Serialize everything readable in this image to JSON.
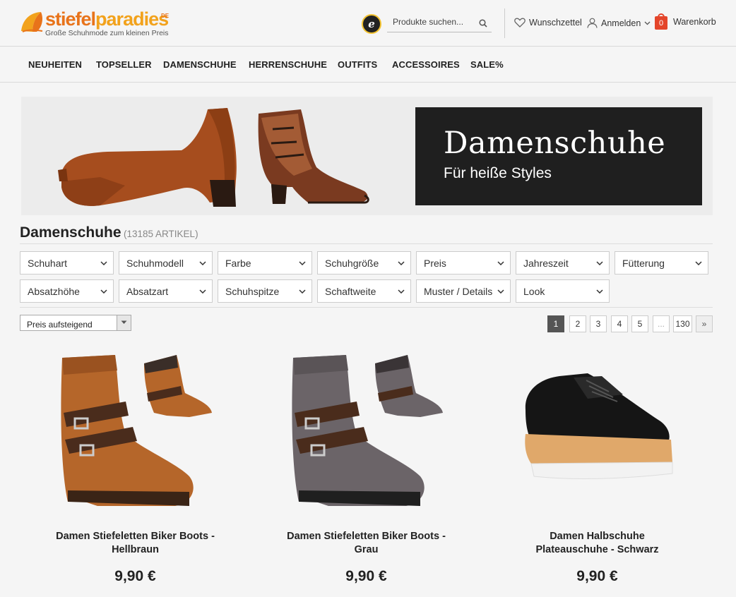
{
  "logo": {
    "part1": "stiefel",
    "part2": "paradies",
    "suffix": "DE",
    "tagline": "Große Schuhmode zum kleinen Preis"
  },
  "header": {
    "search_placeholder": "Produkte suchen...",
    "wishlist": "Wunschzettel",
    "login": "Anmelden",
    "cart": "Warenkorb",
    "cart_count": "0",
    "trust_symbol": "e"
  },
  "nav": [
    "NEUHEITEN",
    "TOPSELLER",
    "DAMENSCHUHE",
    "HERRENSCHUHE",
    "OUTFITS",
    "ACCESSOIRES",
    "SALE%"
  ],
  "banner": {
    "title": "Damenschuhe",
    "subtitle": "Für heiße Styles"
  },
  "page": {
    "title": "Damenschuhe",
    "count": "(13185 ARTIKEL)"
  },
  "filters": [
    "Schuhart",
    "Schuhmodell",
    "Farbe",
    "Schuhgröße",
    "Preis",
    "Jahreszeit",
    "Fütterung",
    "Absatzhöhe",
    "Absatzart",
    "Schuhspitze",
    "Schaftweite",
    "Muster / Details",
    "Look"
  ],
  "sort": {
    "selected": "Preis aufsteigend"
  },
  "pagination": [
    "1",
    "2",
    "3",
    "4",
    "5",
    "...",
    "130",
    "»"
  ],
  "products": [
    {
      "name_line1": "Damen Stiefeletten Biker Boots -",
      "name_line2": "Hellbraun",
      "price": "9,90 €",
      "color": "#b5662a"
    },
    {
      "name_line1": "Damen Stiefeletten Biker Boots -",
      "name_line2": "Grau",
      "price": "9,90 €",
      "color": "#6b6468"
    },
    {
      "name_line1": "Damen Halbschuhe",
      "name_line2": "Plateauschuhe - Schwarz",
      "price": "9,90 €",
      "color": "#151515"
    }
  ],
  "colors": {
    "brand_orange": "#e8731a",
    "brand_yellow": "#f2a21c",
    "cart_red": "#e4452a",
    "banner_dark": "#1f1f1f"
  }
}
